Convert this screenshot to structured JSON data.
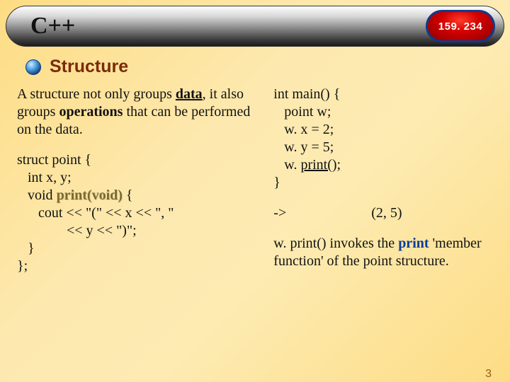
{
  "header": {
    "title": "C++",
    "course_code": "159. 234"
  },
  "subtitle": "Structure",
  "left": {
    "intro_pre": "A structure not only groups ",
    "intro_data": "data",
    "intro_mid": ", it also groups ",
    "intro_ops": "operations",
    "intro_post": " that can be performed on the data.",
    "code_l1": "struct point {",
    "code_l2": "   int x, y;",
    "code_l3a": "   void ",
    "code_l3b": "print(void)",
    "code_l3c": " {",
    "code_l4": "      cout << \"(\" << x << \", \"",
    "code_l5": "              << y << \")\";",
    "code_l6": "   }",
    "code_l7": "};"
  },
  "right": {
    "main_l1": "int main() {",
    "main_l2": "   point w;",
    "main_l3": "   w. x = 2;",
    "main_l4": "   w. y = 5;",
    "main_l5a": "   w. ",
    "main_l5b": "print();",
    "main_l6": "}",
    "arrow": "->",
    "output": "(2, 5)",
    "explain_pre": "w. print() invokes the ",
    "explain_kw": "print",
    "explain_post": " 'member function' of the point structure."
  },
  "page_number": "3"
}
